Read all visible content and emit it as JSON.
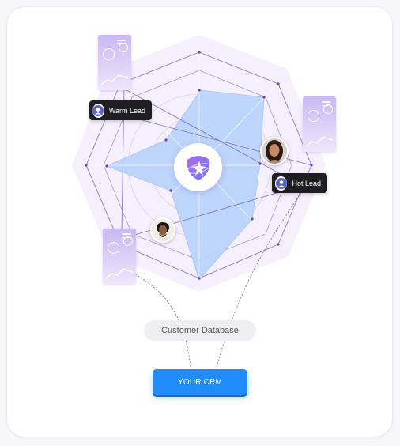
{
  "diagram": {
    "warm_lead_label": "Warm Lead",
    "hot_lead_label": "Hot Lead",
    "database_label": "Customer Database",
    "crm_button_label": "YOUR CRM"
  },
  "colors": {
    "accent_blue": "#1f8cf9",
    "radar_fill": "#b9d3fb",
    "halo": "#f4ecfd",
    "line_purple": "#7b5fc2",
    "tag_bg": "#1f1f23"
  },
  "icons": [
    "star-logo-icon",
    "user-icon",
    "phone-card-icon"
  ]
}
